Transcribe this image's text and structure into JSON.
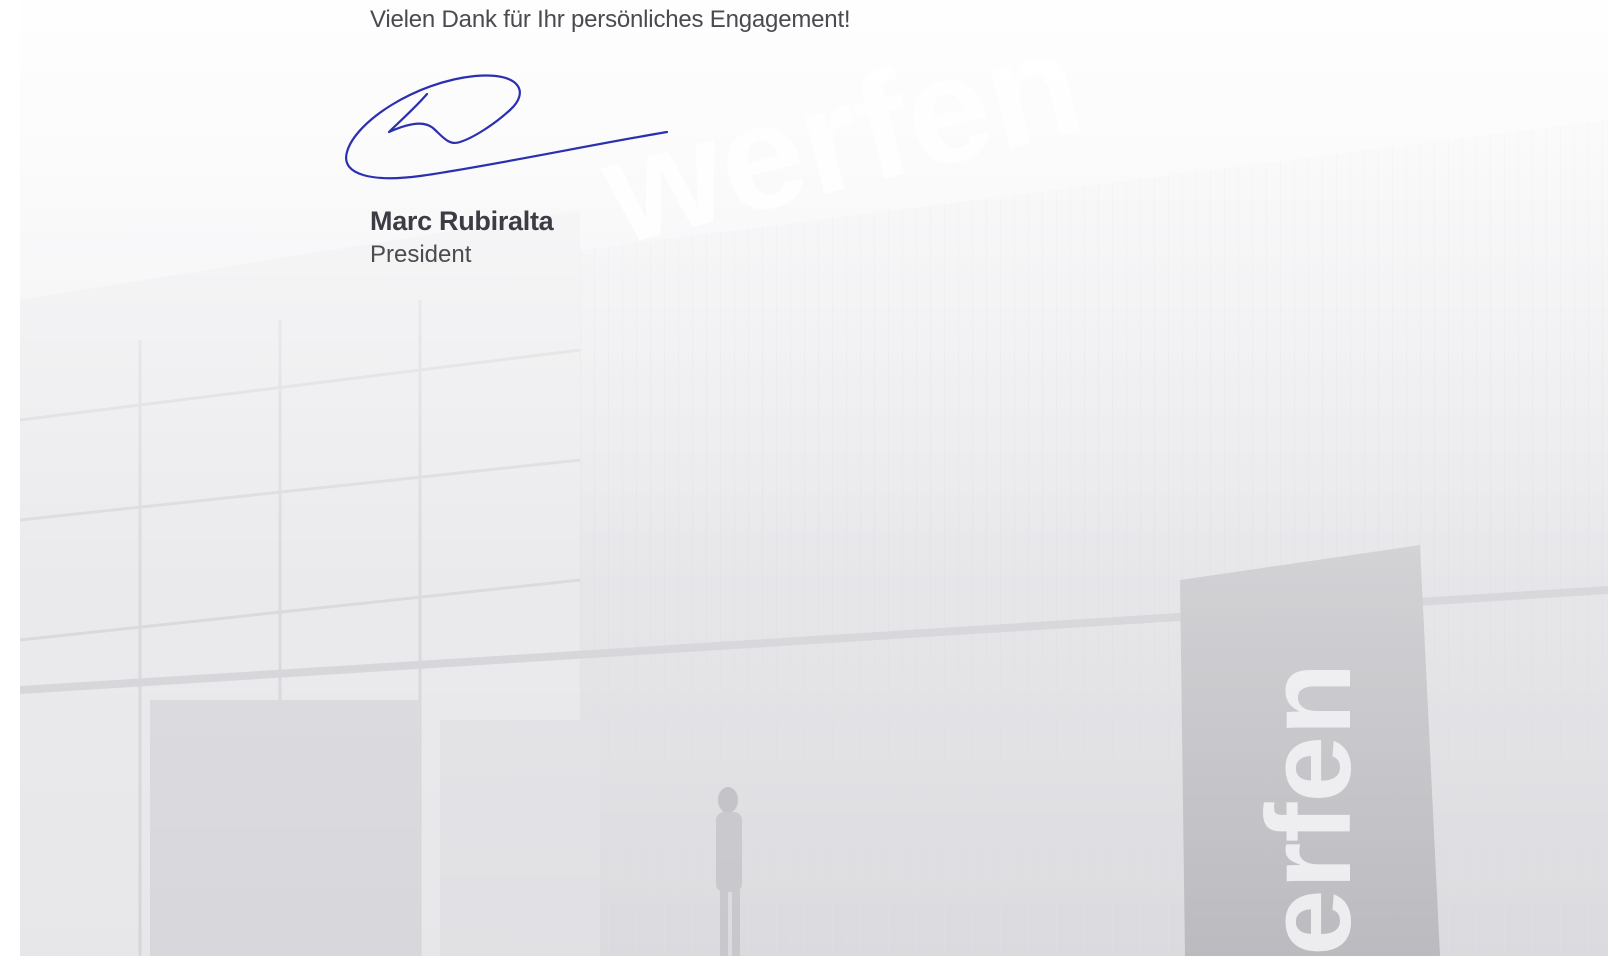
{
  "letter": {
    "closing_text": "Vielen Dank für Ihr persönliches Engagement!",
    "signer_name": "Marc Rubiralta",
    "signer_title": "President"
  },
  "background": {
    "description_icon": "building-photo",
    "logo_wordmark_top": "werfen",
    "logo_wordmark_sign": "erfen"
  },
  "colors": {
    "signature_ink": "#2b2fb0",
    "text": "#4a4a50",
    "name_text": "#3c3c44"
  }
}
